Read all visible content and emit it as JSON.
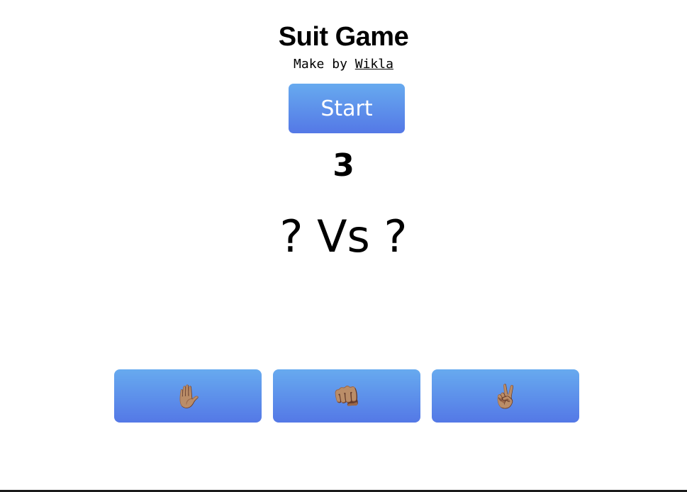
{
  "header": {
    "title": "Suit Game",
    "credit_prefix": "Make by",
    "credit_link": "Wikla"
  },
  "controls": {
    "start_label": "Start"
  },
  "game": {
    "countdown": "3",
    "versus": "? Vs ?"
  },
  "choices": [
    {
      "name": "paper",
      "icon": "raised-hand-icon",
      "glyph": "✋🏽"
    },
    {
      "name": "rock",
      "icon": "fist-icon",
      "glyph": "👊🏽"
    },
    {
      "name": "scissors",
      "icon": "victory-hand-icon",
      "glyph": "✌🏽"
    }
  ],
  "colors": {
    "button_top": "#67aaef",
    "button_bottom": "#5478e6",
    "button_text": "#ffffff"
  }
}
